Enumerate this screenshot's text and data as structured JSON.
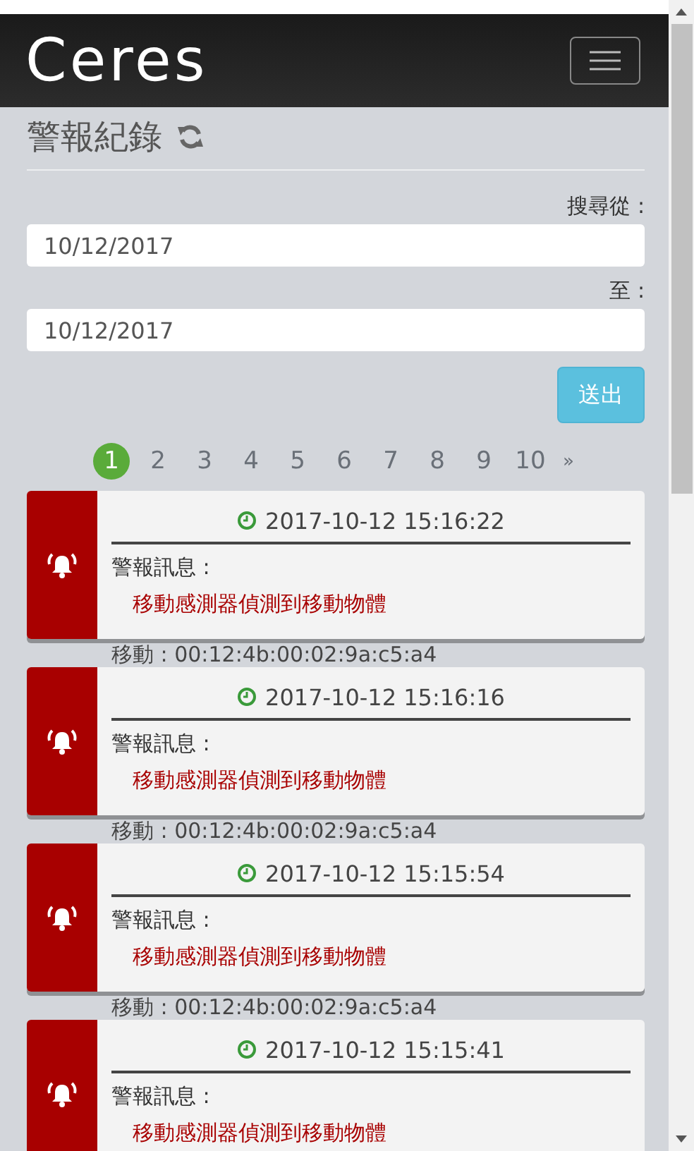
{
  "header": {
    "logo": "Ceres"
  },
  "page_title": "警報紀錄",
  "search": {
    "from_label": "搜尋從 :",
    "from_value": "10/12/2017",
    "to_label": "至 :",
    "to_value": "10/12/2017",
    "submit": "送出"
  },
  "pagination": {
    "pages": [
      {
        "label": "1",
        "selected": true
      },
      {
        "label": "2",
        "selected": false
      },
      {
        "label": "3",
        "selected": false
      },
      {
        "label": "4",
        "selected": false
      },
      {
        "label": "5",
        "selected": false
      },
      {
        "label": "6",
        "selected": false
      },
      {
        "label": "7",
        "selected": false
      },
      {
        "label": "8",
        "selected": false
      },
      {
        "label": "9",
        "selected": false
      },
      {
        "label": "10",
        "selected": false
      }
    ],
    "next": "»"
  },
  "alerts": [
    {
      "time": "2017-10-12 15:16:22",
      "label": "警報訊息 :",
      "message": "移動感測器偵測到移動物體",
      "source": "移動 : 00:12:4b:00:02:9a:c5:a4"
    },
    {
      "time": "2017-10-12 15:16:16",
      "label": "警報訊息 :",
      "message": "移動感測器偵測到移動物體",
      "source": "移動 : 00:12:4b:00:02:9a:c5:a4"
    },
    {
      "time": "2017-10-12 15:15:54",
      "label": "警報訊息 :",
      "message": "移動感測器偵測到移動物體",
      "source": "移動 : 00:12:4b:00:02:9a:c5:a4"
    },
    {
      "time": "2017-10-12 15:15:41",
      "label": "警報訊息 :",
      "message": "移動感測器偵測到移動物體"
    }
  ]
}
